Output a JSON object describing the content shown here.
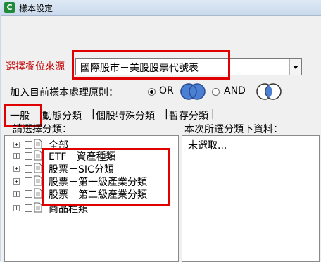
{
  "window": {
    "title": "樣本設定"
  },
  "selector": {
    "label": "選擇欄位來源",
    "value": "國際股市－美股股票代號表"
  },
  "rule": {
    "label": "加入目前樣本處理原則：",
    "options": [
      {
        "label": "OR",
        "checked": true
      },
      {
        "label": "AND",
        "checked": false
      }
    ]
  },
  "tabs": [
    {
      "label": "一般"
    },
    {
      "label": "動態分類"
    },
    {
      "label": "個股特殊分類"
    },
    {
      "label": "暫存分類"
    }
  ],
  "left_panel": {
    "header": "請選擇分類：",
    "items": [
      {
        "label": "全部"
      },
      {
        "label": "ETF－資產種類"
      },
      {
        "label": "股票－SIC分類"
      },
      {
        "label": "股票－第一級產業分類"
      },
      {
        "label": "股票－第二級產業分類"
      },
      {
        "label": "商品種類"
      }
    ]
  },
  "right_panel": {
    "header": "本次所選分類下資料：",
    "items": [
      {
        "label": "未選取..."
      }
    ]
  },
  "colors": {
    "highlight": "#e00000",
    "label_red": "#c00000",
    "venn": "#4a7fd4"
  }
}
